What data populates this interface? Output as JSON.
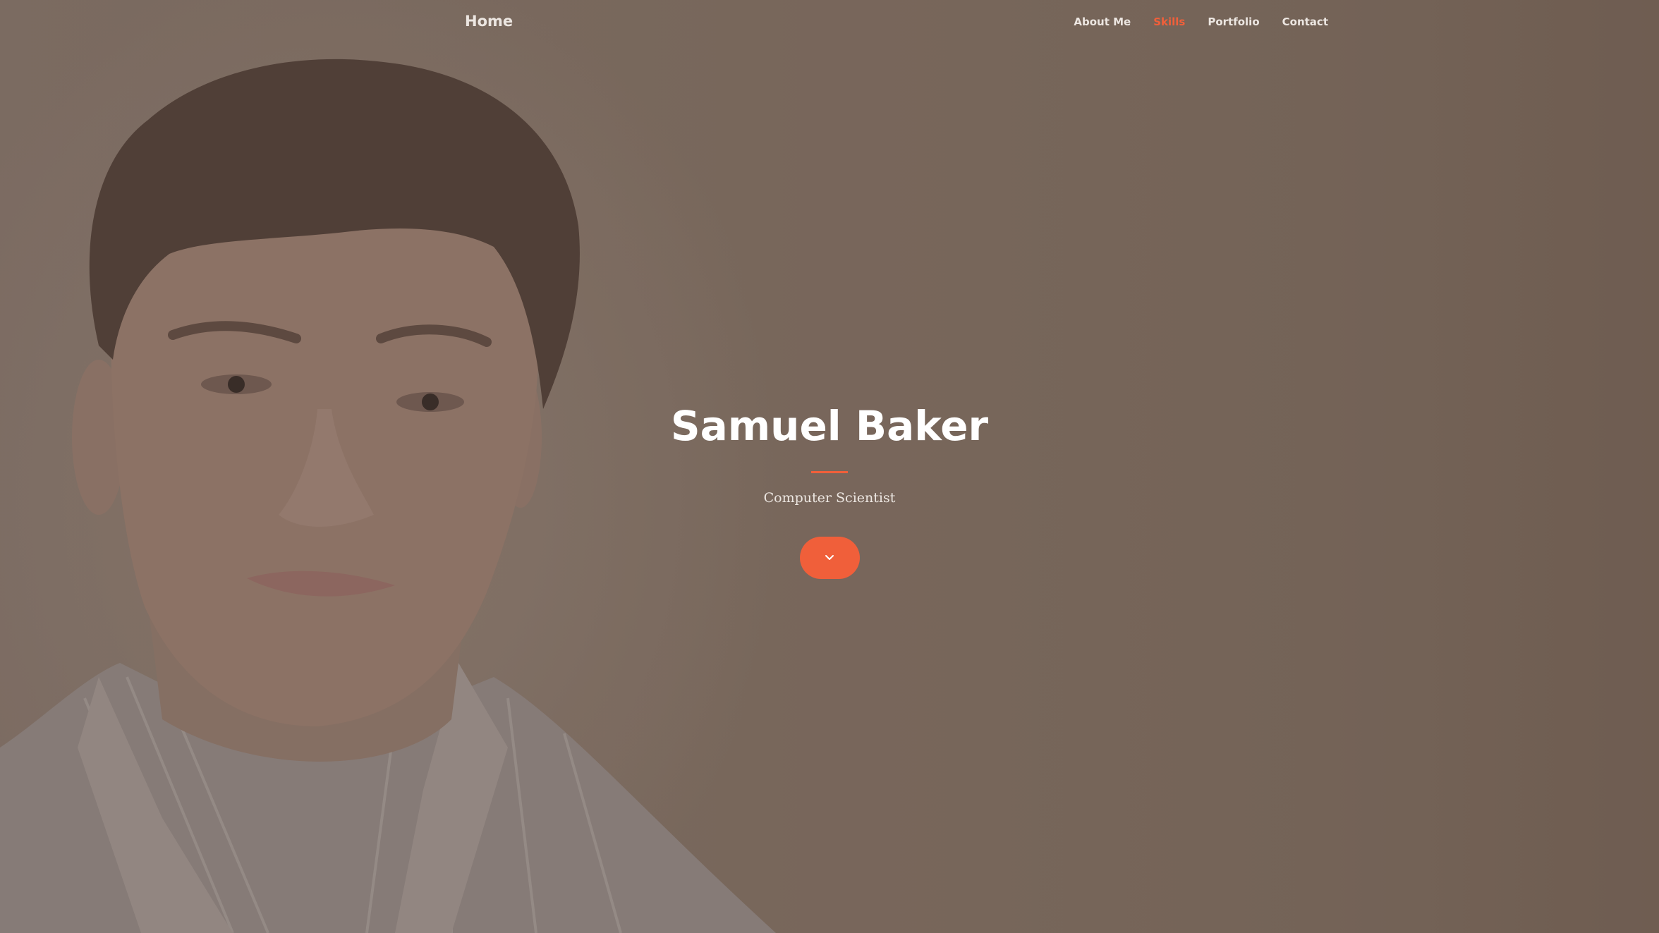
{
  "nav": {
    "brand": "Home",
    "links": [
      {
        "label": "About Me",
        "active": false
      },
      {
        "label": "Skills",
        "active": true
      },
      {
        "label": "Portfolio",
        "active": false
      },
      {
        "label": "Contact",
        "active": false
      }
    ]
  },
  "hero": {
    "title": "Samuel Baker",
    "subtitle": "Computer Scientist",
    "scroll_icon": "chevron-down-icon"
  },
  "colors": {
    "accent": "#f05f3a",
    "text_light": "#ece6e1",
    "background": "#7a6a5e"
  }
}
